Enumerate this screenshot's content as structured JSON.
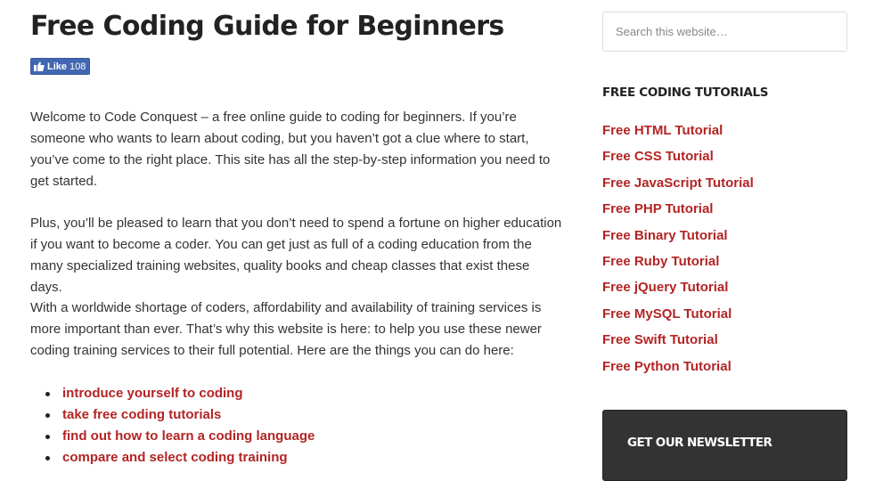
{
  "main": {
    "title": "Free Coding Guide for Beginners",
    "like_button": {
      "label": "Like",
      "count": "108",
      "icon": "thumbs-up-icon",
      "color": "#4267b2"
    },
    "paragraphs": [
      "Welcome to Code Conquest – a free online guide to coding for beginners. If you’re someone who wants to learn about coding, but you haven’t got a clue where to start, you’ve come to the right place. This site has all the step-by-step information you need to get started.",
      "Plus, you’ll be pleased to learn that you don’t need to spend a fortune on higher education if you want to become a coder. You can get just as full of a coding education from the many specialized training websites, quality books and cheap classes that exist these days.",
      "With a worldwide shortage of coders, affordability and availability of training services is more important than ever. That’s why this website is here: to help you use these newer coding training services to their full potential. Here are the things you can do here:"
    ],
    "bullets": [
      "introduce yourself to coding",
      "take free coding tutorials",
      "find out how to learn a coding language",
      "compare and select coding training"
    ],
    "link_color": "#b32424"
  },
  "sidebar": {
    "search": {
      "placeholder": "Search this website…",
      "value": ""
    },
    "tutorials_heading": "FREE CODING TUTORIALS",
    "tutorials": [
      "Free HTML Tutorial",
      "Free CSS Tutorial",
      "Free JavaScript Tutorial",
      "Free PHP Tutorial",
      "Free Binary Tutorial",
      "Free Ruby Tutorial",
      "Free jQuery Tutorial",
      "Free MySQL Tutorial",
      "Free Swift Tutorial",
      "Free Python Tutorial"
    ],
    "newsletter_heading": "GET OUR NEWSLETTER",
    "newsletter_bg": "#333333"
  }
}
